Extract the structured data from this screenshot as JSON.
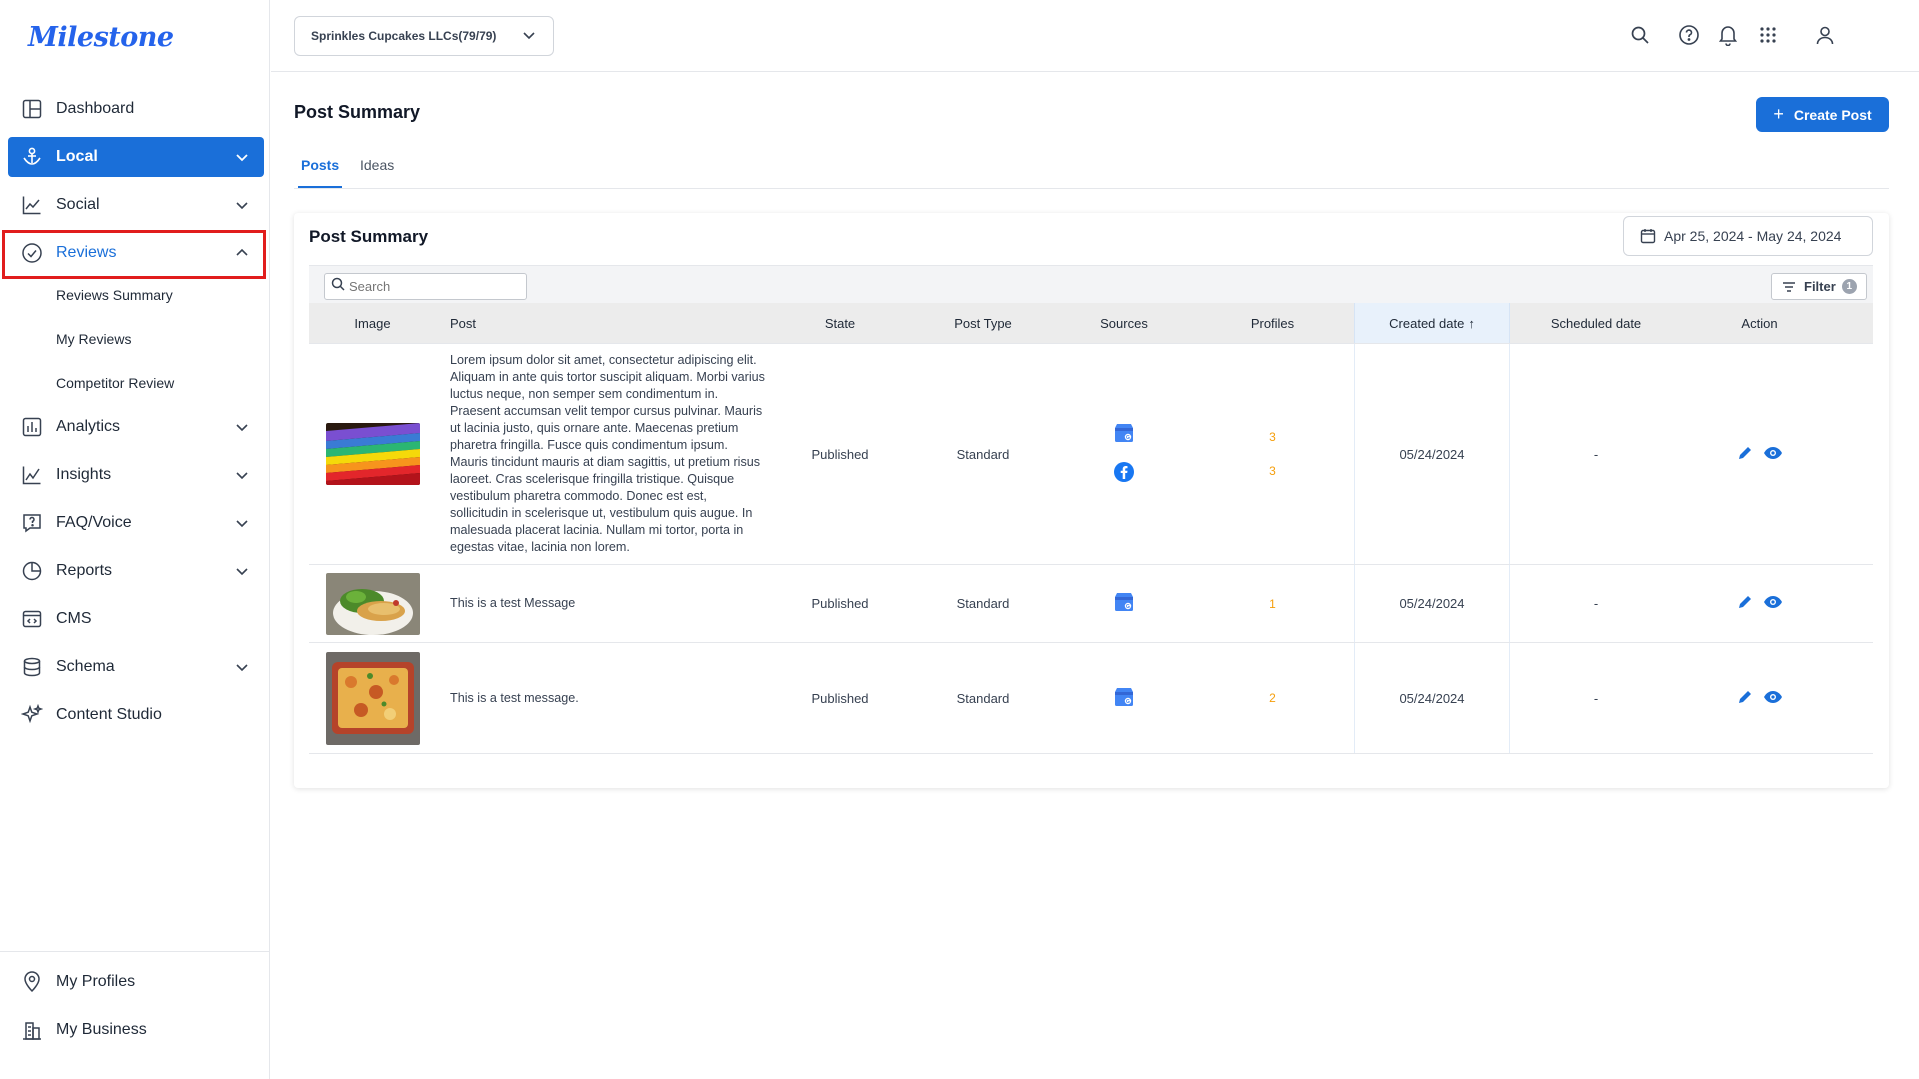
{
  "app": {
    "logo": "Milestone"
  },
  "sidebar": {
    "items": [
      {
        "label": "Dashboard",
        "icon": "dashboard-icon"
      },
      {
        "label": "Local",
        "icon": "local-icon",
        "state": "active"
      },
      {
        "label": "Social",
        "icon": "social-chart-icon"
      },
      {
        "label": "Reviews",
        "icon": "reviews-check-icon",
        "state": "expanded"
      },
      {
        "label": "Analytics",
        "icon": "analytics-icon"
      },
      {
        "label": "Insights",
        "icon": "insights-icon"
      },
      {
        "label": "FAQ/Voice",
        "icon": "faq-icon"
      },
      {
        "label": "Reports",
        "icon": "reports-icon"
      },
      {
        "label": "CMS",
        "icon": "cms-icon"
      },
      {
        "label": "Schema",
        "icon": "schema-icon"
      },
      {
        "label": "Content Studio",
        "icon": "sparkle-icon"
      }
    ],
    "reviews_sub": [
      "Reviews Summary",
      "My Reviews",
      "Competitor Review"
    ],
    "bottom": [
      {
        "label": "My Profiles",
        "icon": "location-pin-icon"
      },
      {
        "label": "My Business",
        "icon": "business-icon"
      }
    ]
  },
  "topbar": {
    "account": "Sprinkles Cupcakes LLCs(79/79)",
    "icons": [
      "search-icon",
      "help-icon",
      "bell-icon",
      "apps-grid-icon",
      "user-icon"
    ]
  },
  "page": {
    "title": "Post Summary",
    "create_button": "Create Post",
    "tabs": [
      "Posts",
      "Ideas"
    ],
    "active_tab": "Posts"
  },
  "card": {
    "title": "Post Summary",
    "date_range": "Apr 25, 2024 - May 24, 2024",
    "search_placeholder": "Search",
    "filter_label": "Filter",
    "filter_count": "1"
  },
  "table": {
    "columns": [
      "Image",
      "Post",
      "State",
      "Post Type",
      "Sources",
      "Profiles",
      "Created date",
      "Scheduled date",
      "Action"
    ],
    "sorted_column": "Created date",
    "sort_indicator": "↑",
    "rows": [
      {
        "image": "colored-pencils",
        "post": "Lorem ipsum dolor sit amet, consectetur adipiscing elit. Aliquam in ante quis tortor suscipit aliquam. Morbi varius luctus neque, non semper sem condimentum in. Praesent accumsan velit tempor cursus pulvinar. Mauris ut lacinia justo, quis ornare ante. Maecenas pretium pharetra fringilla. Fusce quis condimentum ipsum. Mauris tincidunt mauris at diam sagittis, ut pretium risus laoreet. Cras scelerisque fringilla tristique. Quisque vestibulum pharetra commodo. Donec est est, sollicitudin in scelerisque ut, vestibulum quis augue. In malesuada placerat lacinia. Nullam mi tortor, porta in egestas vitae, lacinia non lorem.",
        "state": "Published",
        "type": "Standard",
        "sources": [
          "google-business-icon",
          "facebook-icon"
        ],
        "profiles": [
          "3",
          "3"
        ],
        "created": "05/24/2024",
        "scheduled": "-"
      },
      {
        "image": "salad-plate",
        "post": "This is a test Message",
        "state": "Published",
        "type": "Standard",
        "sources": [
          "google-business-icon"
        ],
        "profiles": [
          "1"
        ],
        "created": "05/24/2024",
        "scheduled": "-"
      },
      {
        "image": "lasagna-dish",
        "post": "This is a test message.",
        "state": "Published",
        "type": "Standard",
        "sources": [
          "google-business-icon"
        ],
        "profiles": [
          "2"
        ],
        "created": "05/24/2024",
        "scheduled": "-"
      }
    ]
  },
  "colors": {
    "accent": "#1a6fd9",
    "profiles": "#f59e0b",
    "highlight": "#e11d1d"
  }
}
